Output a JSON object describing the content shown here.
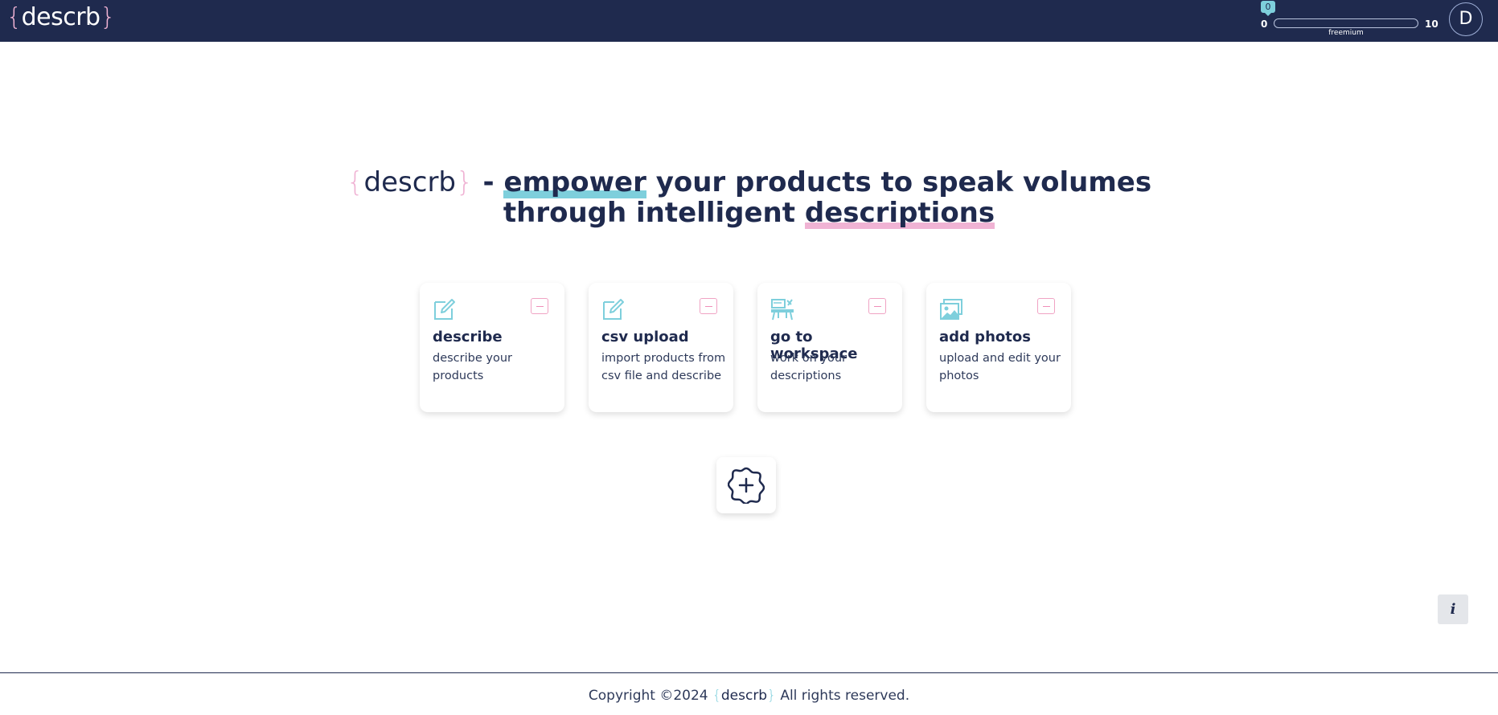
{
  "header": {
    "logo_open": "{",
    "logo_text": "descrb",
    "logo_close": "}",
    "usage": {
      "badge": "0",
      "min": "0",
      "max": "10",
      "plan": "freemium",
      "value": 0
    },
    "avatar_initial": "D"
  },
  "hero": {
    "brand_open": "{",
    "brand_text": "descrb",
    "brand_close": "}",
    "dash": " - ",
    "word_highlight_1": "empower",
    "line1_rest": " your products to speak volumes",
    "line2_start": "through intelligent ",
    "word_highlight_2": "descriptions"
  },
  "cards": [
    {
      "title": "describe",
      "desc": "describe your products",
      "icon": "edit-icon"
    },
    {
      "title": "csv upload",
      "desc": "import products from csv file and describe",
      "icon": "edit-icon"
    },
    {
      "title": "go to workspace",
      "desc": "work on your descriptions",
      "icon": "workspace-icon"
    },
    {
      "title": "add photos",
      "desc": "upload and edit your photos",
      "icon": "photos-icon"
    }
  ],
  "add_button": {
    "icon": "add-badge-icon"
  },
  "info_button": {
    "label": "i"
  },
  "footer": {
    "prefix": "Copyright ©2024 ",
    "brand_open": "{",
    "brand_text": "descrb",
    "brand_close": "}",
    "suffix": " All rights reserved."
  },
  "colors": {
    "navy": "#1f2a4e",
    "teal": "#7ecfdc",
    "pink": "#f0b3d4"
  }
}
